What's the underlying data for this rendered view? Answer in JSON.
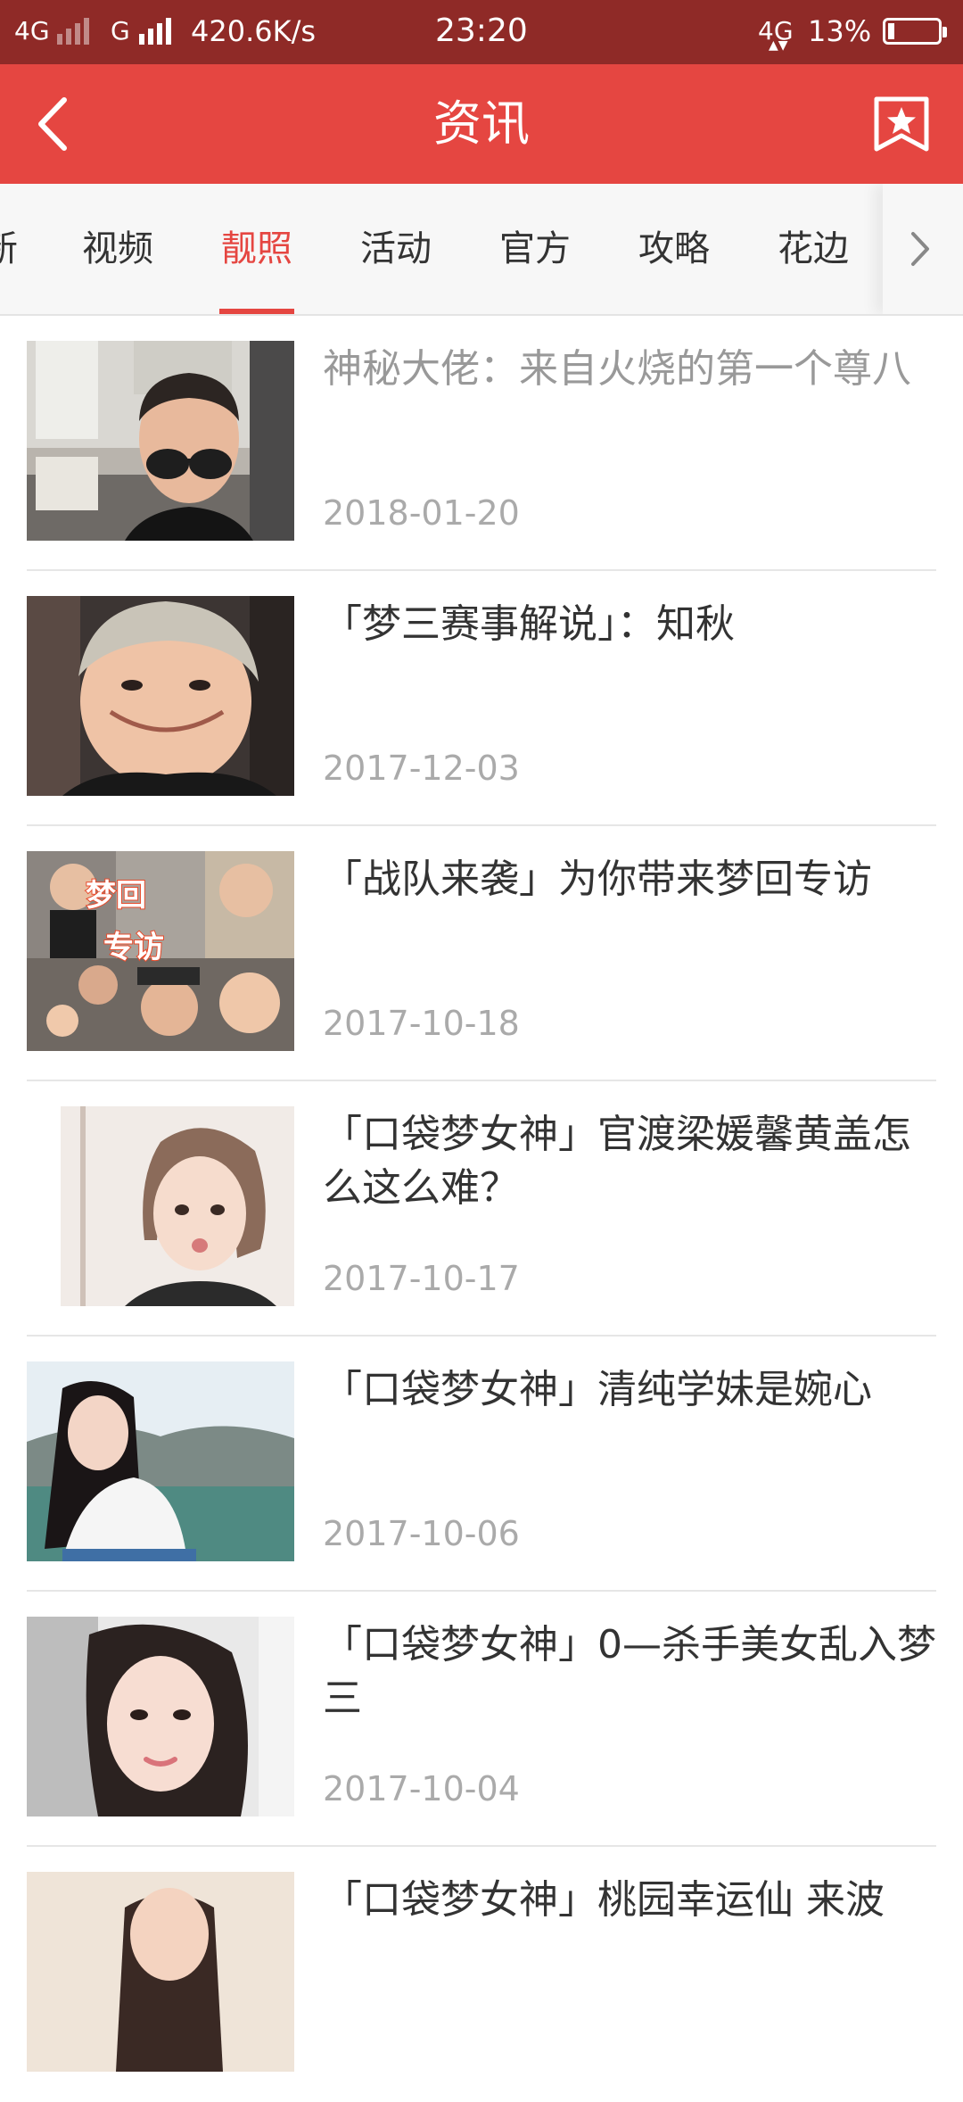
{
  "status_bar": {
    "network1": "4G",
    "network2": "G",
    "speed": "420.6K/s",
    "time": "23:20",
    "network3": "4G",
    "battery": "13%",
    "battery_level": 0.13
  },
  "header": {
    "title": "资讯",
    "back_icon": "chevron-left-icon",
    "bookmark_icon": "star-bookmark-icon"
  },
  "tabs": [
    {
      "label": "新"
    },
    {
      "label": "视频"
    },
    {
      "label": "靓照",
      "active": true
    },
    {
      "label": "活动"
    },
    {
      "label": "官方"
    },
    {
      "label": "攻略"
    },
    {
      "label": "花边"
    }
  ],
  "news": [
    {
      "title": "神秘大佬：来自火烧的第一个尊八",
      "date": "2018-01-20",
      "read": true
    },
    {
      "title": "「梦三赛事解说」：知秋",
      "date": "2017-12-03"
    },
    {
      "title": "「战队来袭」为你带来梦回专访",
      "date": "2017-10-18",
      "thumb_text1": "梦回",
      "thumb_text2": "专访"
    },
    {
      "title": "「口袋梦女神」官渡梁媛馨黄盖怎么这么难？",
      "date": "2017-10-17"
    },
    {
      "title": "「口袋梦女神」清纯学妹是婉心",
      "date": "2017-10-06"
    },
    {
      "title": "「口袋梦女神」0—杀手美女乱入梦三",
      "date": "2017-10-04"
    },
    {
      "title": "「口袋梦女神」桃园幸运仙 来波",
      "date": ""
    }
  ],
  "colors": {
    "accent": "#e54641",
    "status_bar": "#8f2a27"
  }
}
